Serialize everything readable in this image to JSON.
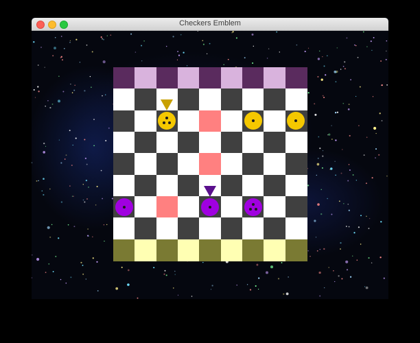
{
  "window": {
    "title": "Checkers Emblem"
  },
  "colors": {
    "dark_square": "#404040",
    "light_square": "#ffffff",
    "highlight": "#ff8080",
    "top_goal_dark": "#5a2b5e",
    "top_goal_light": "#d9b3dd",
    "bottom_goal_dark": "#7a7a33",
    "bottom_goal_light": "#ffffb3",
    "yellow_team": "#f5c800",
    "purple_team": "#a000e0",
    "yellow_arrow": "#c8a000",
    "purple_arrow": "#5a0f8c"
  },
  "board": {
    "rows": 9,
    "cols": 9,
    "highlighted": [
      [
        2,
        4
      ],
      [
        4,
        4
      ],
      [
        6,
        2
      ]
    ],
    "pieces": [
      {
        "team": "yellow",
        "row": 2,
        "col": 2,
        "pips": 3,
        "selected": true
      },
      {
        "team": "yellow",
        "row": 2,
        "col": 6,
        "pips": 1
      },
      {
        "team": "yellow",
        "row": 2,
        "col": 8,
        "pips": 1
      },
      {
        "team": "purple",
        "row": 6,
        "col": 0,
        "pips": 1
      },
      {
        "team": "purple",
        "row": 6,
        "col": 4,
        "pips": 1,
        "selected": true
      },
      {
        "team": "purple",
        "row": 6,
        "col": 6,
        "pips": 3
      }
    ]
  }
}
